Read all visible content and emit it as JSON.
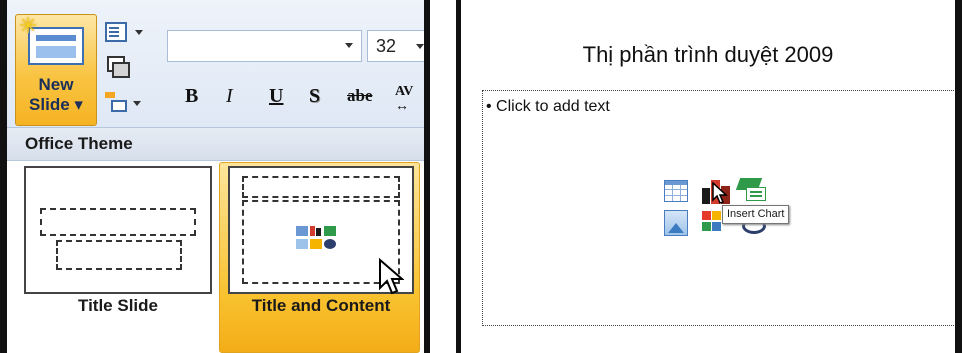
{
  "ribbon": {
    "new_slide_label_line1": "New",
    "new_slide_label_line2": "Slide ▾",
    "font_size_value": "32",
    "bold_label": "B",
    "italic_label": "I",
    "underline_label": "U",
    "shadow_label": "S",
    "strikethrough_label": "abe",
    "spacing_label": "AV",
    "spacing_arrow": "↔"
  },
  "layout_gallery": {
    "header": "Office Theme",
    "layouts": [
      {
        "label": "Title Slide",
        "selected": false
      },
      {
        "label": "Title and Content",
        "selected": true
      }
    ]
  },
  "slide": {
    "title": "Thị phần trình duyệt 2009",
    "bullet_placeholder": "• Click to add text",
    "tooltip": "Insert Chart",
    "insert_icons": [
      "insert-table-icon",
      "insert-chart-icon",
      "insert-smartart-icon",
      "insert-picture-icon",
      "insert-clipart-icon",
      "insert-media-icon"
    ]
  },
  "colors": {
    "accent_selected": "#f8c22f",
    "ribbon_bg": "#dfe8f5",
    "border_dark": "#111111"
  }
}
